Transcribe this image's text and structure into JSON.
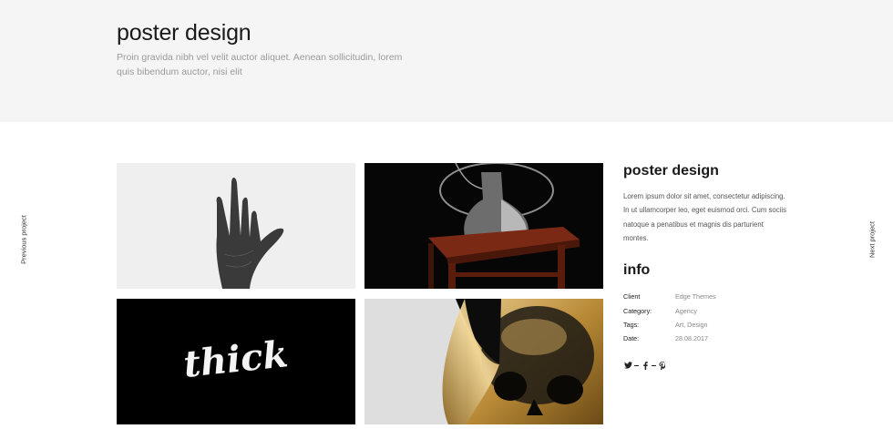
{
  "header": {
    "title": "poster design",
    "subtitle": "Proin gravida nibh vel velit auctor aliquet. Aenean sollicitudin, lorem quis bibendum auctor, nisi elit"
  },
  "nav": {
    "previous": "Previous project",
    "next": "Next project"
  },
  "gallery": {
    "thick_text": "thick"
  },
  "project": {
    "title": "poster design",
    "description": "Lorem ipsum dolor sit amet, consectetur adipiscing. In ut ullamcorper leo, eget euismod orci. Cum sociis natoque a penatibus et magnis dis parturient montes."
  },
  "info": {
    "title": "info",
    "rows": [
      {
        "label": "Client",
        "value": "Edge Themes"
      },
      {
        "label": "Category:",
        "value": "Agency"
      },
      {
        "label": "Tags:",
        "value": "Art, Design"
      },
      {
        "label": "Date:",
        "value": "28.08.2017"
      }
    ]
  },
  "social": [
    "twitter-icon",
    "facebook-icon",
    "pinterest-icon"
  ],
  "colors": {
    "hero_bg": "#f5f5f5",
    "text": "#1a1a1a",
    "muted": "#9a9a9a",
    "gold": "#c79a3e"
  }
}
